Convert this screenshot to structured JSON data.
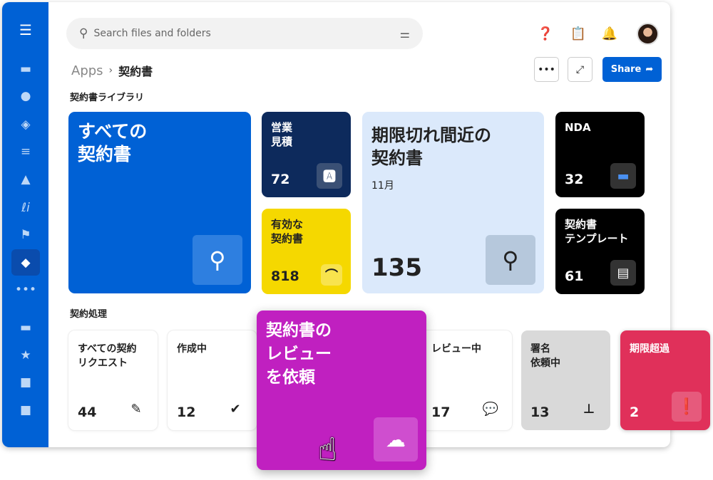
{
  "search": {
    "placeholder": "Search files and folders"
  },
  "breadcrumb": {
    "root": "Apps",
    "current": "契約書"
  },
  "toolbar": {
    "more": "•••",
    "share_label": "Share"
  },
  "library": {
    "label": "契約書ライブラリ",
    "all": {
      "title": "すべての\n契約書"
    },
    "sales": {
      "title": "営業\n見積",
      "count": "72"
    },
    "valid": {
      "title": "有効な\n契約書",
      "count": "818"
    },
    "expiring": {
      "title": "期限切れ間近の\n契約書",
      "sub": "11月",
      "count": "135"
    },
    "nda": {
      "title": "NDA",
      "count": "32"
    },
    "templates": {
      "title": "契約書\nテンプレート",
      "count": "61"
    }
  },
  "process": {
    "label": "契約処理",
    "all": {
      "title": "すべての契約\nリクエスト",
      "count": "44"
    },
    "draft": {
      "title": "作成中",
      "count": "12"
    },
    "request": {
      "title": "契約書の\nレビュー\nを依頼"
    },
    "review": {
      "title": "レビュー中",
      "count": "17"
    },
    "sign": {
      "title": "署名\n依頼中",
      "count": "13"
    },
    "overdue": {
      "title": "期限超過",
      "count": "2"
    }
  },
  "colors": {
    "brand": "#0061d5",
    "navy": "#0d2a5c",
    "yellow": "#f5d800",
    "lightblue": "#dbe9fb",
    "magenta": "#c020c0",
    "red": "#e0305a"
  }
}
